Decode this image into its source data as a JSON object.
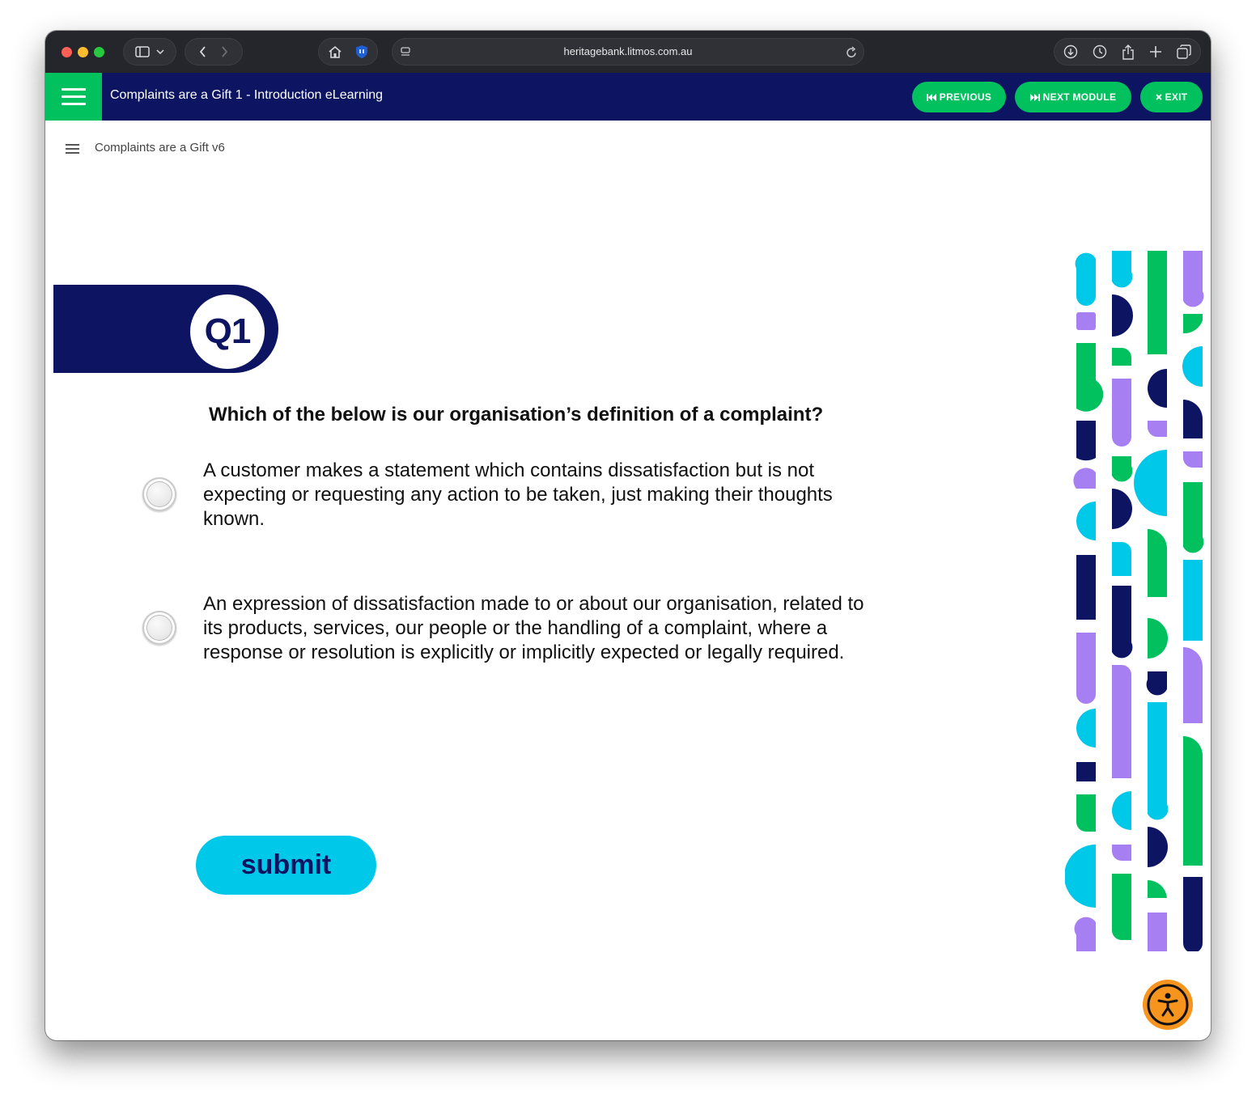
{
  "browser": {
    "url": "heritagebank.litmos.com.au"
  },
  "header": {
    "course_title": "Complaints are a Gift 1 - Introduction eLearning",
    "previous_label": "PREVIOUS",
    "next_label": "NEXT MODULE",
    "exit_label": "EXIT"
  },
  "subheader": {
    "title": "Complaints are a Gift v6"
  },
  "quiz": {
    "number": "Q1",
    "question": "Which of the below is our organisation’s definition of a complaint?",
    "options": [
      {
        "lines": [
          "A customer makes a statement which contains dissatisfaction but is not",
          "expecting or requesting any action to be taken, just making their thoughts",
          "known."
        ]
      },
      {
        "lines": [
          "An expression of dissatisfaction made to or about our organisation, related to",
          "its products, services, our people or the handling of a complaint, where a",
          "response or resolution is explicitly or implicitly expected or legally required."
        ]
      }
    ],
    "submit_label": "submit"
  },
  "icons": {
    "menu": "hamburger-icon",
    "previous": "skip-back-icon",
    "next": "skip-forward-icon",
    "exit": "close-icon",
    "accessibility": "accessibility-icon"
  },
  "colors": {
    "navy": "#0d1563",
    "green": "#00c15e",
    "cyan": "#00c8e8",
    "purple": "#a67ff2",
    "orange": "#f7941d"
  }
}
